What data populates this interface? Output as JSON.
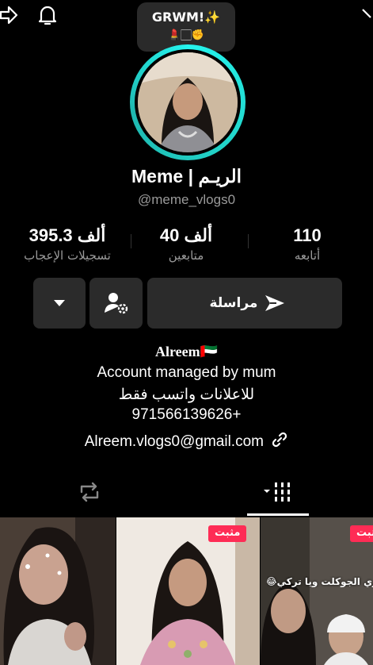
{
  "status_bubble": {
    "title": "GRWM!✨",
    "emojis": "💄🏻✊"
  },
  "profile": {
    "display_name": "Meme | الريـم",
    "username": "@meme_vlogs0"
  },
  "stats": [
    {
      "value": "395.3 ألف",
      "label": "تسجيلات الإعجاب"
    },
    {
      "value": "40 ألف",
      "label": "متابعين"
    },
    {
      "value": "110",
      "label": "أتابعه"
    }
  ],
  "actions": {
    "message_label": "مراسلة"
  },
  "bio": {
    "name": "Alreem🇦🇪",
    "lines": [
      "Account managed by mum",
      "للاعلانات واتسب فقط",
      "971566139626+"
    ],
    "email": "Alreem.vlogs0@gmail.com"
  },
  "videos": [
    {
      "badge": ""
    },
    {
      "badge": "مثبت"
    },
    {
      "badge": "مثبت",
      "caption": "ري الجوكلت ويا تركي😂😭"
    }
  ],
  "colors": {
    "accent_ring": "#25f4ee",
    "pin_badge": "#fe2c55",
    "button_bg": "#2b2b2b",
    "muted_text": "#9a9a9a"
  },
  "icons": [
    "share-icon",
    "bell-icon",
    "chevron-down-icon",
    "person-settings-icon",
    "send-icon",
    "link-icon",
    "repost-tab-icon",
    "grid-tab-icon"
  ]
}
